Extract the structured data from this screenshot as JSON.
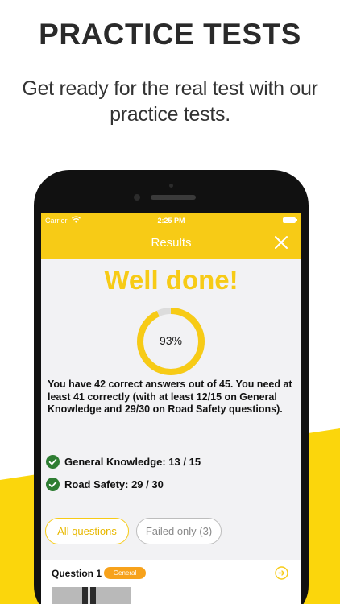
{
  "promo": {
    "headline": "PRACTICE TESTS",
    "subline": "Get ready for the real test with our practice tests."
  },
  "status_bar": {
    "carrier": "Carrier",
    "time": "2:25 PM"
  },
  "header": {
    "title": "Results"
  },
  "results": {
    "heading": "Well done!",
    "percent_label": "93%",
    "percent_value": 93,
    "summary": "You have 42 correct answers out of 45. You need at least 41 correctly (with at least 12/15 on General Knowledge and 29/30 on Road Safety questions).",
    "scores": [
      {
        "label": "General Knowledge: 13 / 15"
      },
      {
        "label": "Road Safety: 29 / 30"
      }
    ]
  },
  "filters": {
    "all_label": "All questions",
    "failed_label": "Failed only (3)"
  },
  "question": {
    "title": "Question 1",
    "badge": "General"
  },
  "colors": {
    "accent": "#f7cb16",
    "success": "#2e7d32",
    "badge": "#f7a21b"
  }
}
